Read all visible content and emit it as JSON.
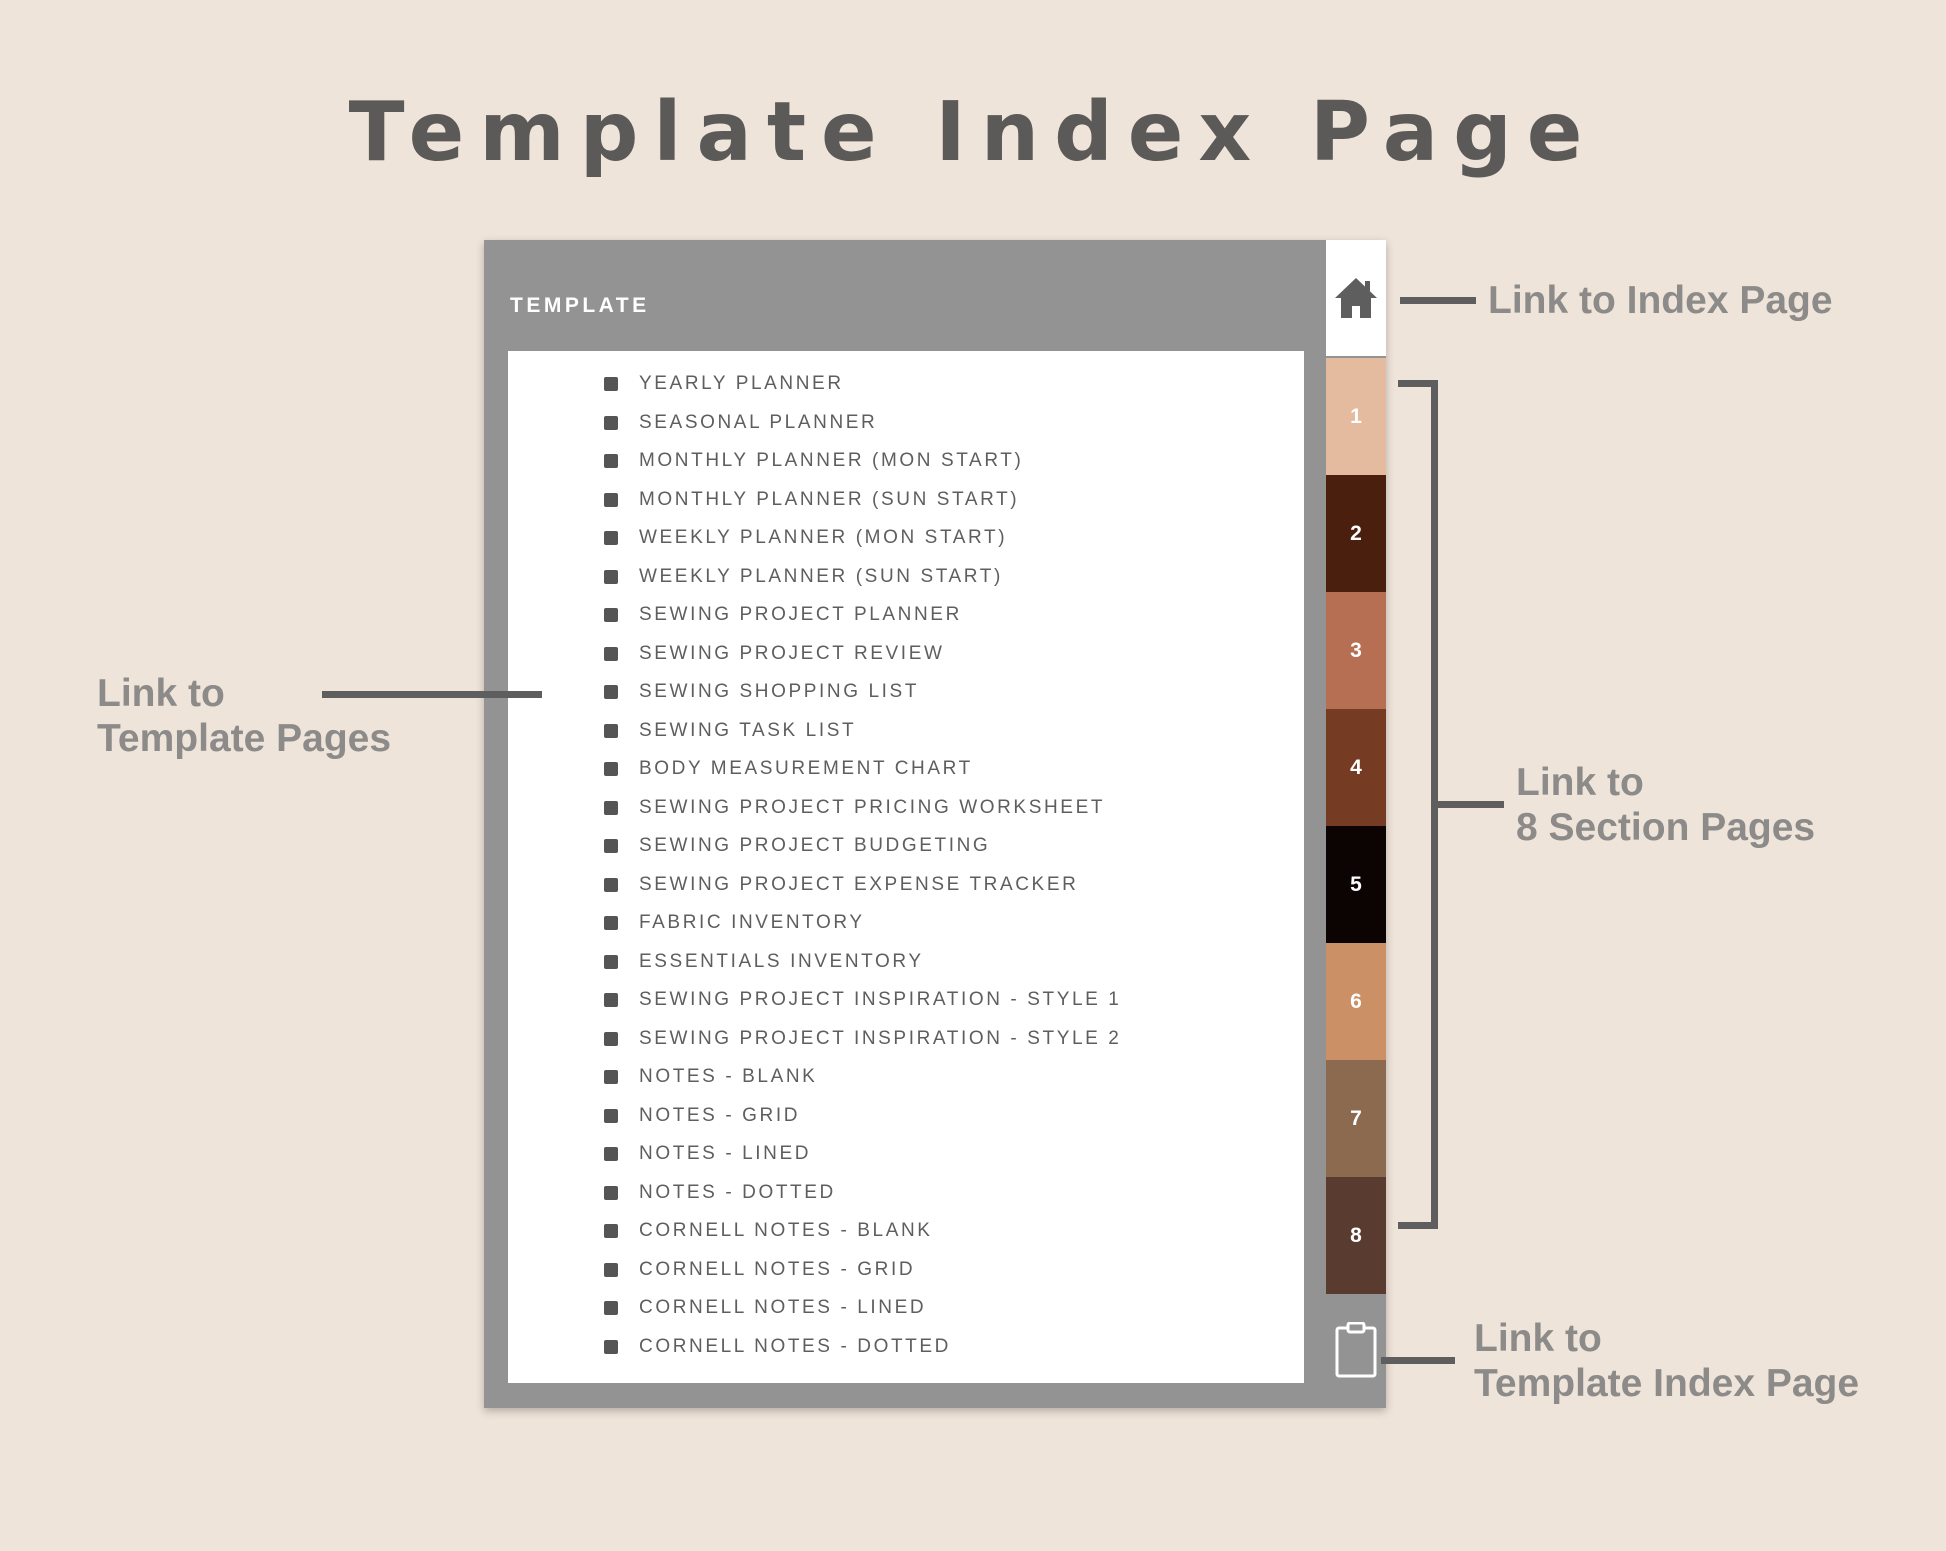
{
  "page": {
    "title": "Template Index Page"
  },
  "device": {
    "header": "TEMPLATE",
    "template_items": [
      "YEARLY PLANNER",
      "SEASONAL PLANNER",
      "MONTHLY PLANNER (MON START)",
      "MONTHLY PLANNER (SUN START)",
      "WEEKLY PLANNER (MON START)",
      "WEEKLY PLANNER (SUN START)",
      "SEWING PROJECT PLANNER",
      "SEWING PROJECT REVIEW",
      "SEWING SHOPPING LIST",
      "SEWING TASK LIST",
      "BODY MEASUREMENT CHART",
      "SEWING PROJECT PRICING WORKSHEET",
      "SEWING PROJECT BUDGETING",
      "SEWING PROJECT EXPENSE TRACKER",
      "FABRIC INVENTORY",
      "ESSENTIALS INVENTORY",
      "SEWING PROJECT INSPIRATION - STYLE 1",
      "SEWING PROJECT INSPIRATION - STYLE 2",
      "NOTES - BLANK",
      "NOTES - GRID",
      "NOTES - LINED",
      "NOTES - DOTTED",
      "CORNELL NOTES - BLANK",
      "CORNELL NOTES - GRID",
      "CORNELL NOTES - LINED",
      "CORNELL NOTES - DOTTED"
    ],
    "home_tab_icon": "home-icon",
    "section_tabs": [
      {
        "label": "1",
        "color": "#e5bb9f"
      },
      {
        "label": "2",
        "color": "#4a1f0e"
      },
      {
        "label": "3",
        "color": "#b66f52"
      },
      {
        "label": "4",
        "color": "#763b23"
      },
      {
        "label": "5",
        "color": "#0c0303"
      },
      {
        "label": "6",
        "color": "#cb9066"
      },
      {
        "label": "7",
        "color": "#8b6a4f"
      },
      {
        "label": "8",
        "color": "#593b30"
      }
    ],
    "template_index_tab_icon": "clipboard-icon"
  },
  "annotations": {
    "index_page": [
      "Link to Index Page"
    ],
    "template_pages": [
      "Link to",
      "Template Pages"
    ],
    "section_pages": [
      "Link to",
      "8 Section Pages"
    ],
    "template_index_page": [
      "Link to",
      "Template Index Page"
    ]
  },
  "colors": {
    "background": "#efe4da",
    "device_frame": "#939393",
    "annotation_text": "#8c8b89",
    "title_text": "#5b5a58",
    "connector": "#5e5e5e"
  }
}
